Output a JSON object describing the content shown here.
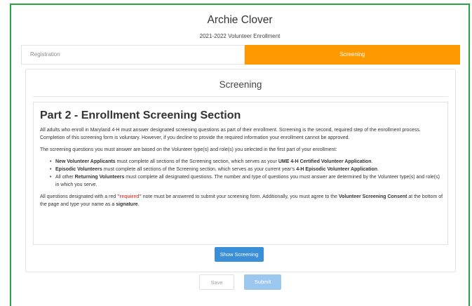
{
  "header": {
    "title": "Archie Clover",
    "subtitle": "2021-2022 Volunteer Enrollment"
  },
  "steps": {
    "registration": "Registration",
    "screening": "Screening"
  },
  "panel": {
    "title": "Screening"
  },
  "section": {
    "heading": "Part 2 - Enrollment Screening Section",
    "intro": "All adults who enroll in Maryland 4-H must answer designated screening questions as part of their enrollment.  Screening is the second, required step of the enrollment process.  Completion of this screening form is voluntary.  However, if you decline to provide the required information your enrollment cannot be approved.",
    "basis": "The screening questions you must answer are based on the Volunteer type(s) and role(s) you selected in the first part of your enrollment:",
    "bullets": {
      "b1_bold": "New Volunteer Applicants",
      "b1_text": " must complete all sections of the Screening section, which serves as your ",
      "b1_bold2": "UME 4-H Certified Volunteer Application",
      "b1_end": ".",
      "b2_bold": "Episodic Volunteers",
      "b2_text": " must complete all sections of the Screening section, which serves as your current year's ",
      "b2_bold2": "4-H Episodic Volunteer Application",
      "b2_end": ".",
      "b3_pre": "All other ",
      "b3_bold": "Returning Volunteers",
      "b3_text": " must complete all designated questions.  The number and type of questions you must answer are determined by the Volunteer type(s) and role(s) in which you serve."
    },
    "footer": {
      "pre": "All questions designated with a red ",
      "req": "\"required\"",
      "mid": " note must be answered to submit your screening form.  Additionally, you must agree to the ",
      "bold1": "Volunteer Screening Consent",
      "mid2": " at the bottom of the page and type your name as a ",
      "bold2": "signature",
      "end": "."
    }
  },
  "buttons": {
    "show_screening": "Show Screening",
    "save": "Save",
    "submit": "Submit"
  },
  "colors": {
    "frame_border": "#27a83e",
    "active_step": "#ff9900",
    "primary_button": "#3a8fd6",
    "required_text": "#d9534f"
  }
}
